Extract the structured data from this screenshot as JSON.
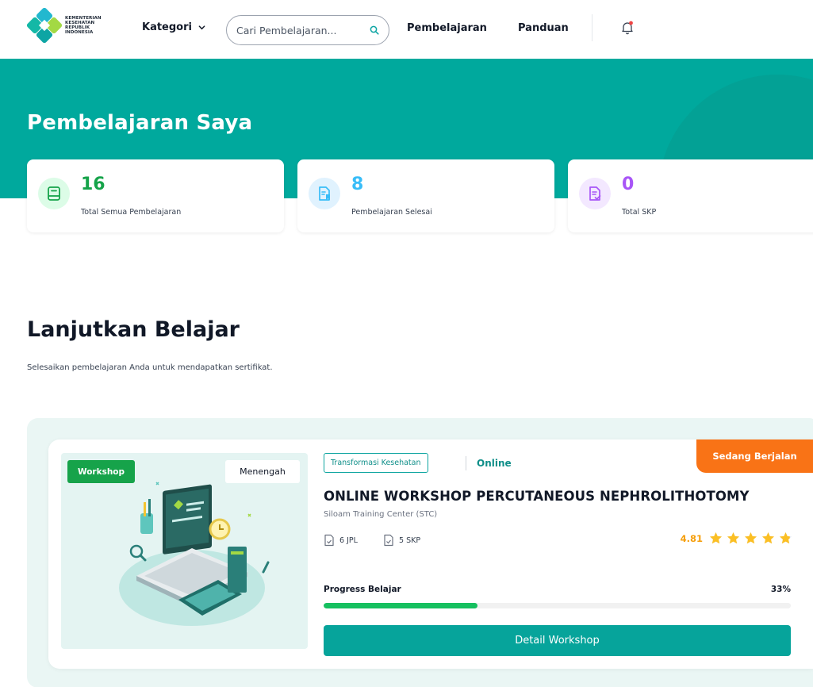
{
  "header": {
    "logo_text": [
      "KEMENTERIAN",
      "KESEHATAN",
      "REPUBLIK",
      "INDONESIA"
    ],
    "kategori_label": "Kategori",
    "search_placeholder": "Cari Pembelajaran...",
    "nav": {
      "pembelajaran": "Pembelajaran",
      "panduan": "Panduan"
    },
    "notification_dot_color": "#ef4444",
    "icons": {
      "dropdown": "chevron-down-icon",
      "search": "search-icon",
      "notification": "bell-icon"
    }
  },
  "hero": {
    "title": "Pembelajaran Saya",
    "background_color": "#00a99d"
  },
  "stats": [
    {
      "value": "16",
      "label": "Total Semua Pembelajaran",
      "color": "#16a34a",
      "icon_bg": "#dcfce7",
      "icon": "book-icon"
    },
    {
      "value": "8",
      "label": "Pembelajaran Selesai",
      "color": "#38bdf8",
      "icon_bg": "#e0f2fe",
      "icon": "document-bookmark-icon"
    },
    {
      "value": "0",
      "label": "Total SKP",
      "color": "#a855f7",
      "icon_bg": "#f3e8ff",
      "icon": "document-check-icon"
    }
  ],
  "section": {
    "title": "Lanjutkan Belajar",
    "subtitle": "Selesaikan pembelajaran Anda untuk mendapatkan sertifikat."
  },
  "course": {
    "type_badge": "Workshop",
    "level_badge": "Menengah",
    "category_tag": "Transformasi Kesehatan",
    "mode": "Online",
    "status": "Sedang Berjalan",
    "title": "ONLINE WORKSHOP PERCUTANEOUS NEPHROLITHOTOMY",
    "provider": "Siloam Training Center (STC)",
    "jpl": "6 JPL",
    "skp": "5 SKP",
    "rating": "4.81",
    "rating_value": 4.81,
    "rating_max": 5,
    "progress_label": "Progress Belajar",
    "progress_text": "33%",
    "progress_value": 0.33,
    "button_label": "Detail Workshop",
    "colors": {
      "status": "#f97316",
      "type_badge": "#16a34a",
      "button": "#06a49b",
      "progress": "#16c060",
      "stars": "#fbbf24"
    }
  }
}
